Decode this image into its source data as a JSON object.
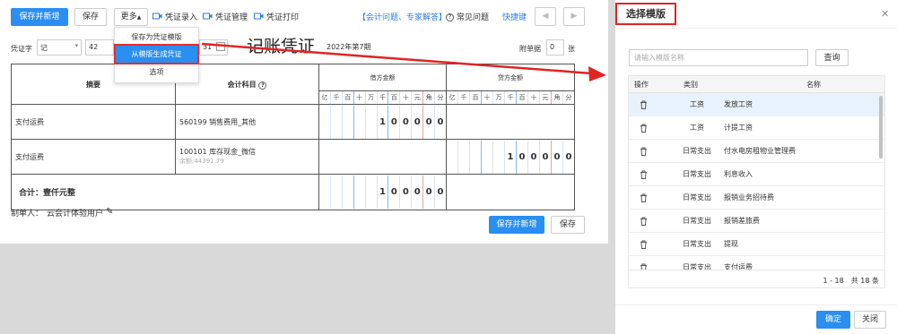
{
  "toolbar": {
    "save_new": "保存并新增",
    "save": "保存",
    "more": "更多",
    "voucher_entry": "凭证录入",
    "voucher_manage": "凭证管理",
    "voucher_print": "凭证打印",
    "help_link": "【会计问题、专家解答】",
    "faq": "常见问题",
    "shortcut": "快捷键"
  },
  "more_menu": [
    "保存为凭证模版",
    "从模版生成凭证",
    "选项"
  ],
  "voucher": {
    "word_label": "凭证字",
    "word_value": "记",
    "number": "42",
    "date_suffix": "31",
    "title": "记账凭证",
    "period": "2022年第7期",
    "attach_label": "附单据",
    "attach_value": "0",
    "attach_unit": "张"
  },
  "table": {
    "col_summary": "摘要",
    "col_account": "会计科目",
    "col_debit": "借方金额",
    "col_credit": "贷方金额",
    "units": [
      "亿",
      "千",
      "百",
      "十",
      "万",
      "千",
      "百",
      "十",
      "元",
      "角",
      "分"
    ],
    "rows": [
      {
        "summary": "支付运费",
        "account": "560199 销售费用_其他",
        "balance": "",
        "debit": [
          "",
          "",
          "",
          "",
          "",
          "1",
          "0",
          "0",
          "0",
          "0",
          "0"
        ],
        "credit": [
          "",
          "",
          "",
          "",
          "",
          "",
          "",
          "",
          "",
          "",
          ""
        ]
      },
      {
        "summary": "支付运费",
        "account": "100101 库存现金_微信",
        "balance": "余额:44391.79",
        "debit": [
          "",
          "",
          "",
          "",
          "",
          "",
          "",
          "",
          "",
          "",
          ""
        ],
        "credit": [
          "",
          "",
          "",
          "",
          "",
          "1",
          "0",
          "0",
          "0",
          "0",
          "0"
        ]
      }
    ],
    "total_label": "合计：壹仟元整",
    "total_debit": [
      "",
      "",
      "",
      "",
      "",
      "1",
      "0",
      "0",
      "0",
      "0",
      "0"
    ],
    "total_credit": [
      "",
      "",
      "",
      "",
      "",
      "",
      "",
      "",
      "",
      "",
      ""
    ]
  },
  "maker_label": "制单人：",
  "maker": "云会计体验用户",
  "footer": {
    "save_new": "保存并新增",
    "save": "保存"
  },
  "dialog": {
    "title": "选择模版",
    "search_placeholder": "请输入模版名称",
    "query": "查询",
    "col_op": "操作",
    "col_category": "类别",
    "col_name": "名称",
    "rows": [
      {
        "category": "工资",
        "name": "发放工资"
      },
      {
        "category": "工资",
        "name": "计提工资"
      },
      {
        "category": "日常支出",
        "name": "付水电房租物业管理费"
      },
      {
        "category": "日常支出",
        "name": "利息收入"
      },
      {
        "category": "日常支出",
        "name": "报销业务招待费"
      },
      {
        "category": "日常支出",
        "name": "报销差旅费"
      },
      {
        "category": "日常支出",
        "name": "提现"
      },
      {
        "category": "日常支出",
        "name": "支付运费"
      }
    ],
    "pagination": "1 - 18　共 18 条",
    "confirm": "确定",
    "close": "关闭"
  },
  "colors": {
    "primary": "#2a8ff0",
    "highlight": "#e52d2d",
    "row_selected": "#e8f2fc"
  }
}
